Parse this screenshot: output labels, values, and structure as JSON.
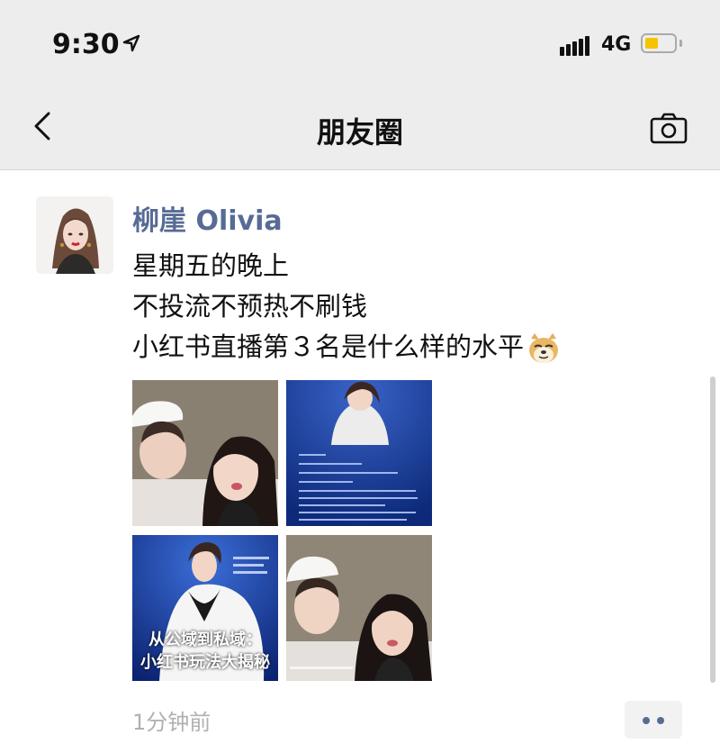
{
  "status_bar": {
    "time": "9:30",
    "network": "4G",
    "battery_color": "#f5c400"
  },
  "nav": {
    "title": "朋友圈",
    "back_icon": "chevron-left-icon",
    "camera_icon": "camera-icon"
  },
  "post": {
    "author": "柳崖 Olivia",
    "lines": [
      "星期五的晚上",
      "不投流不预热不刷钱",
      "小红书直播第３名是什么样的水平"
    ],
    "images": [
      {
        "caption": ""
      },
      {
        "caption": ""
      },
      {
        "caption": "从公域到私域：\n小红书玩法大揭秘"
      },
      {
        "caption": ""
      }
    ],
    "time_ago": "1分钟前",
    "more_icon": "more-dots-icon"
  },
  "colors": {
    "name": "#576b95",
    "header_bg": "#ededed"
  }
}
